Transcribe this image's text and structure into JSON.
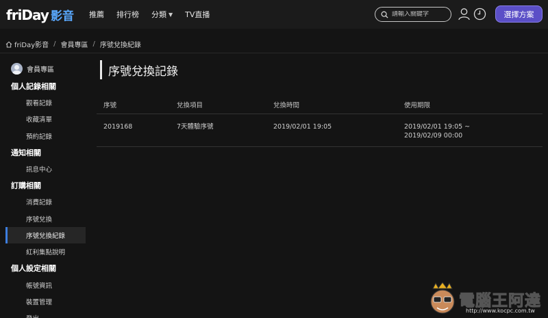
{
  "header": {
    "logo_text": "friDay",
    "logo_zh": "影音",
    "nav": [
      {
        "label": "推薦"
      },
      {
        "label": "排行榜"
      },
      {
        "label": "分類"
      },
      {
        "label": "TV直播"
      }
    ],
    "search_placeholder": "請輸入關鍵字",
    "plan_button": "選擇方案"
  },
  "breadcrumb": [
    "friDay影音",
    "會員專區",
    "序號兌換紀錄"
  ],
  "sidebar": {
    "member_label": "會員專區",
    "sections": [
      {
        "title": "個人記錄相關",
        "items": [
          "觀看記錄",
          "收藏清單",
          "預約記錄"
        ]
      },
      {
        "title": "通知相關",
        "items": [
          "訊息中心"
        ]
      },
      {
        "title": "訂購相關",
        "items": [
          "消費記錄",
          "序號兌換",
          "序號兌換紀錄",
          "紅利集點說明"
        ]
      },
      {
        "title": "個人設定相關",
        "items": [
          "帳號資訊",
          "裝置管理",
          "登出"
        ]
      }
    ],
    "active_item": "序號兌換紀錄"
  },
  "main": {
    "title": "序號兌換記錄",
    "table": {
      "headers": [
        "序號",
        "兌換項目",
        "兌換時間",
        "使用期限"
      ],
      "rows": [
        {
          "serial": "2019168",
          "item": "7天體驗序號",
          "time": "2019/02/01 19:05",
          "expiry_start": "2019/02/01 19:05 ~",
          "expiry_end": "2019/02/09 00:00"
        }
      ]
    }
  },
  "watermark": {
    "text": "電腦王阿達",
    "url": "http://www.kocpc.com.tw"
  },
  "colors": {
    "accent": "#5b4fc7",
    "active_indicator": "#3d7ee0",
    "logo_blue": "#5aa9ff"
  }
}
